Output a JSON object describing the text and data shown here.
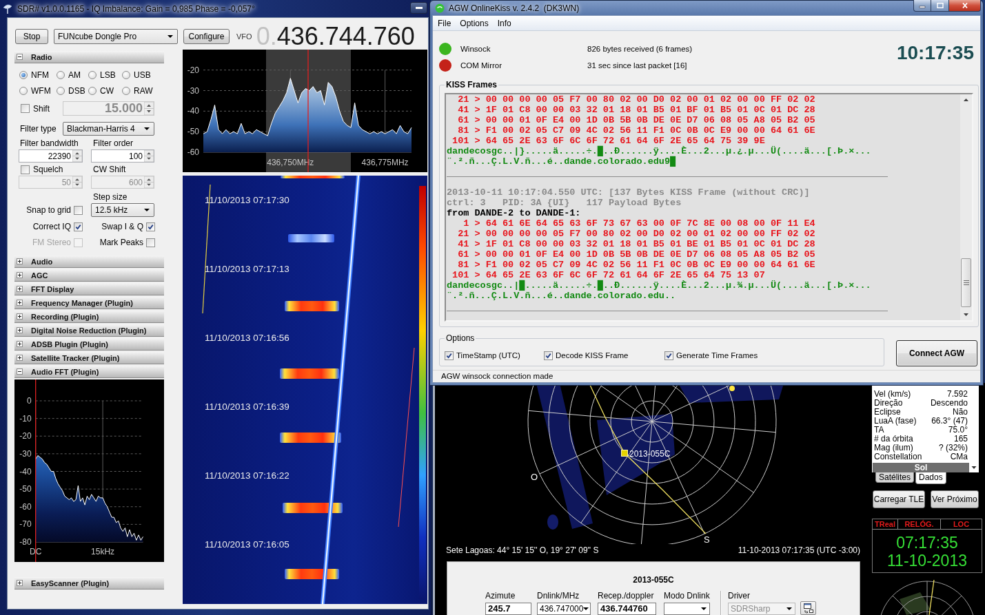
{
  "sdr": {
    "title": "SDR# v1.0.0.1165 - IQ Imbalance: Gain = 0,985 Phase = -0,057°",
    "toolbar": {
      "stop": "Stop",
      "device": "FUNcube Dongle Pro",
      "configure": "Configure",
      "vfo_label": "VFO",
      "vfo_dim": "0.",
      "vfo_value": "436.744.760"
    },
    "panels": [
      {
        "title": "Radio",
        "expanded": true,
        "kind": "radio",
        "modes": [
          {
            "label": "NFM",
            "selected": true
          },
          {
            "label": "AM",
            "selected": false
          },
          {
            "label": "LSB",
            "selected": false
          },
          {
            "label": "USB",
            "selected": false
          },
          {
            "label": "WFM",
            "selected": false
          },
          {
            "label": "DSB",
            "selected": false
          },
          {
            "label": "CW",
            "selected": false
          },
          {
            "label": "RAW",
            "selected": false
          }
        ],
        "shift": {
          "label": "Shift",
          "checked": false,
          "value": "15.000",
          "disabled": true
        },
        "filter_type": {
          "label": "Filter type",
          "value": "Blackman-Harris 4"
        },
        "filter_bandwidth": {
          "label": "Filter bandwidth",
          "value": "22390",
          "disabled": false
        },
        "filter_order": {
          "label": "Filter order",
          "value": "100",
          "disabled": false
        },
        "squelch": {
          "label": "Squelch",
          "checked": false,
          "value": "50",
          "disabled": true
        },
        "cw_shift": {
          "label": "CW Shift",
          "value": "600",
          "disabled": true
        },
        "step_size": {
          "label": "Step size",
          "value": "12.5 kHz"
        },
        "options": [
          {
            "label": "Snap to grid",
            "checked": false,
            "disabled": false
          },
          {
            "label": "Correct IQ",
            "checked": true,
            "disabled": false
          },
          {
            "label": "Swap I & Q",
            "checked": true,
            "disabled": false
          },
          {
            "label": "FM Stereo",
            "checked": false,
            "disabled": true
          },
          {
            "label": "Mark Peaks",
            "checked": false,
            "disabled": false
          }
        ]
      },
      {
        "title": "Audio",
        "expanded": false
      },
      {
        "title": "AGC",
        "expanded": false
      },
      {
        "title": "FFT Display",
        "expanded": false
      },
      {
        "title": "Frequency Manager (Plugin)",
        "expanded": false
      },
      {
        "title": "Recording (Plugin)",
        "expanded": false
      },
      {
        "title": "Digital Noise Reduction (Plugin)",
        "expanded": false
      },
      {
        "title": "ADSB Plugin (Plugin)",
        "expanded": false
      },
      {
        "title": "Satellite Tracker (Plugin)",
        "expanded": false
      },
      {
        "title": "Audio FFT (Plugin)",
        "expanded": true,
        "kind": "audio_fft",
        "chart_data": {
          "type": "area",
          "categories": [
            "DC",
            null,
            null,
            null,
            null,
            null,
            null,
            null,
            null,
            null,
            null,
            null,
            null,
            null,
            null,
            null,
            null,
            null,
            null,
            null,
            null,
            null,
            null,
            null,
            null,
            null,
            null,
            null,
            null,
            null,
            "15kHz",
            null,
            null,
            null,
            null,
            null,
            null,
            null,
            null,
            null,
            null,
            null,
            null,
            null,
            null,
            null,
            null,
            null,
            null
          ],
          "values": [
            -33,
            -31,
            -32,
            -33,
            -35,
            -36,
            -38,
            -40,
            -40,
            -44,
            -47,
            -49,
            -51,
            -54,
            -55,
            -56,
            -55,
            -57,
            -56,
            -48,
            -57,
            -55,
            -59,
            -54,
            -56,
            -53,
            -55,
            -57,
            -54,
            -55,
            -55,
            -58,
            -60,
            -63,
            -66,
            -66,
            -69,
            -68,
            -72,
            -74,
            -72,
            -77,
            -73,
            -77,
            -75,
            -79,
            -76,
            -79,
            -77
          ],
          "ylim": [
            -80,
            0
          ],
          "yticks": [
            -80,
            -70,
            -60,
            -50,
            -40,
            -30,
            -20,
            -10,
            0
          ],
          "grid": true
        }
      },
      {
        "title": "EasyScanner (Plugin)",
        "expanded": false
      }
    ],
    "spectrum": {
      "chart_data": {
        "type": "area",
        "categories": [
          null,
          null,
          null,
          null,
          null,
          null,
          null,
          null,
          null,
          null,
          null,
          null,
          null,
          null,
          null,
          null,
          null,
          null,
          null,
          null,
          null,
          null,
          null,
          "436,750MHz",
          null,
          null,
          null,
          null,
          null,
          null,
          null,
          null,
          null,
          null,
          null,
          null,
          null,
          null,
          null,
          null,
          null,
          null,
          null,
          null,
          null,
          null,
          null,
          null,
          "436,775MHz",
          null,
          null,
          null,
          null,
          null,
          null,
          null
        ],
        "values": [
          -51,
          -50,
          -44,
          -37,
          -49,
          -51,
          -49,
          -51,
          -50,
          -51,
          -46,
          -51,
          -50,
          -51,
          -49,
          -50,
          -51,
          -52,
          -46,
          -41,
          -38,
          -35,
          -31,
          -24,
          -30,
          -36,
          -31,
          -29,
          -30,
          -28,
          -31,
          -30,
          -37,
          -26,
          -28,
          -33,
          -40,
          -45,
          -47,
          -48,
          -36,
          -47,
          -49,
          -50,
          -51,
          -50,
          -51,
          -50,
          -51,
          -50,
          -49,
          -51,
          -47,
          -50,
          -51,
          -48
        ],
        "ylim": [
          -60,
          -20
        ],
        "yticks": [
          -60,
          -50,
          -40,
          -30,
          -20
        ],
        "grid": true
      }
    },
    "waterfall": {
      "timestamps": [
        "11/10/2013 07:17:30",
        "11/10/2013 07:17:13",
        "11/10/2013 07:16:56",
        "11/10/2013 07:16:39",
        "11/10/2013 07:16:22",
        "11/10/2013 07:16:05"
      ]
    }
  },
  "agw": {
    "title": "AGW OnlineKiss v. 2.4.2  (DK3WN)",
    "menu": [
      "File",
      "Options",
      "Info"
    ],
    "status": [
      {
        "label": "Winsock",
        "info": "826 bytes received (6 frames)",
        "color": "#3bb51f"
      },
      {
        "label": "COM Mirror",
        "info": "31 sec since last packet [16]",
        "color": "#c42219"
      }
    ],
    "clock": "10:17:35",
    "kiss_frames": {
      "title": "KISS Frames",
      "lines": [
        {
          "kind": "hex",
          "text": "  21 > 00 00 00 00 05 F7 00 80 02 00 D0 02 00 01 02 00 00 FF 02 02"
        },
        {
          "kind": "hex",
          "text": "  41 > 1F 01 C8 00 00 03 32 01 18 01 B5 01 BF 01 B5 01 0C 01 DC 28"
        },
        {
          "kind": "hex",
          "text": "  61 > 00 00 01 0F E4 00 1D 0B 5B 0B DE 0E D7 06 08 05 A8 05 B2 05"
        },
        {
          "kind": "hex",
          "text": "  81 > F1 00 02 05 C7 09 4C 02 56 11 F1 0C 0B 0C E9 00 00 64 61 6E"
        },
        {
          "kind": "hex",
          "text": " 101 > 64 65 2E 63 6F 6C 6F 72 61 64 6F 2E 65 64 75 39 9E"
        },
        {
          "kind": "ascii",
          "text": "dandecosgc..|}.....ä.....÷.█..Ð......ÿ....È...2...µ.¿.µ...Ü(....ä...[.Þ.×..."
        },
        {
          "kind": "ascii",
          "text": "¨.².ñ...Ç.L.V.ñ...é..dande.colorado.edu9█"
        },
        {
          "kind": "separator"
        },
        {
          "kind": "info",
          "text": "2013-10-11 10:17:04.550 UTC: [137 Bytes KISS Frame (without CRC)]"
        },
        {
          "kind": "info",
          "text": "ctrl: 3   PID: 3A {UI}   117 Payload Bytes"
        },
        {
          "kind": "address",
          "text": "from DANDE-2 to DANDE-1:"
        },
        {
          "kind": "hex",
          "text": "   1 > 64 61 6E 64 65 63 6F 73 67 63 00 0F 7C 8E 00 08 00 0F 11 E4"
        },
        {
          "kind": "hex",
          "text": "  21 > 00 00 00 00 05 F7 00 80 02 00 D0 02 00 01 02 00 00 FF 02 02"
        },
        {
          "kind": "hex",
          "text": "  41 > 1F 01 C8 00 00 03 32 01 18 01 B5 01 BE 01 B5 01 0C 01 DC 28"
        },
        {
          "kind": "hex",
          "text": "  61 > 00 00 01 0F E4 00 1D 0B 5B 0B DE 0E D7 06 08 05 A8 05 B2 05"
        },
        {
          "kind": "hex",
          "text": "  81 > F1 00 02 05 C7 09 4C 02 56 11 F1 0C 0B 0C E9 00 00 64 61 6E"
        },
        {
          "kind": "hex",
          "text": " 101 > 64 65 2E 63 6F 6C 6F 72 61 64 6F 2E 65 64 75 13 07"
        },
        {
          "kind": "ascii",
          "text": "dandecosgc..|█.....ä.....÷.█..Ð......ÿ....È...2...µ.¾.µ...Ü(....ä...[.Þ.×..."
        },
        {
          "kind": "ascii",
          "text": "¨.².ñ...Ç.L.V.ñ...é..dande.colorado.edu.."
        },
        {
          "kind": "separator"
        }
      ]
    },
    "options": {
      "title": "Options",
      "checkboxes": [
        {
          "label": "TimeStamp (UTC)",
          "checked": true
        },
        {
          "label": "Decode KISS Frame",
          "checked": true
        },
        {
          "label": "Generate Time Frames",
          "checked": true
        }
      ]
    },
    "connect_button": "Connect AGW",
    "status_bar": "AGW winsock connection made"
  },
  "tracker": {
    "plot": {
      "satellite": "2013-055C",
      "directions": [
        "O",
        "S"
      ]
    },
    "location": "Sete Lagoas: 44° 15' 15'' O, 19° 27' 09'' S",
    "datetime": "11-10-2013 07:17:35 (UTC -3:00)",
    "pass_panel": {
      "title": "2013-055C",
      "fields": [
        {
          "label": "Azimute",
          "value": "245.7",
          "kind": "text",
          "disabled": false
        },
        {
          "label": "Dnlink/MHz",
          "value": "436.747000",
          "kind": "dropdown",
          "disabled": false
        },
        {
          "label": "Recep./doppler",
          "value": "436.744760",
          "kind": "text",
          "disabled": false
        },
        {
          "label": "Modo Dnlink",
          "kind": "dropdown",
          "disabled": false
        },
        {
          "label": "Driver",
          "value": "SDRSharp",
          "kind": "dropdown",
          "disabled": true
        }
      ]
    },
    "data_rows": [
      {
        "label": "Vel (km/s)",
        "value": "7.592"
      },
      {
        "label": "Direção",
        "value": "Descendo"
      },
      {
        "label": "Eclipse",
        "value": "Não"
      },
      {
        "label": "LuaA (fase)",
        "value": "66.3° (47)"
      },
      {
        "label": "TA",
        "value": "75.0°"
      },
      {
        "label": "# da órbita",
        "value": "165"
      },
      {
        "label": "Mag (ilum)",
        "value": "? (32%)"
      },
      {
        "label": "Constellation",
        "value": "CMa"
      }
    ],
    "section": "Sol",
    "tabs": [
      {
        "label": "Satélites",
        "selected": false
      },
      {
        "label": "Dados",
        "selected": true
      }
    ],
    "buttons": [
      "Carregar TLE",
      "Ver Próximo"
    ],
    "clock": {
      "headers": [
        "TReal",
        "RELÓG.",
        "LOC"
      ],
      "time": "07:17:35",
      "date": "11-10-2013"
    }
  }
}
